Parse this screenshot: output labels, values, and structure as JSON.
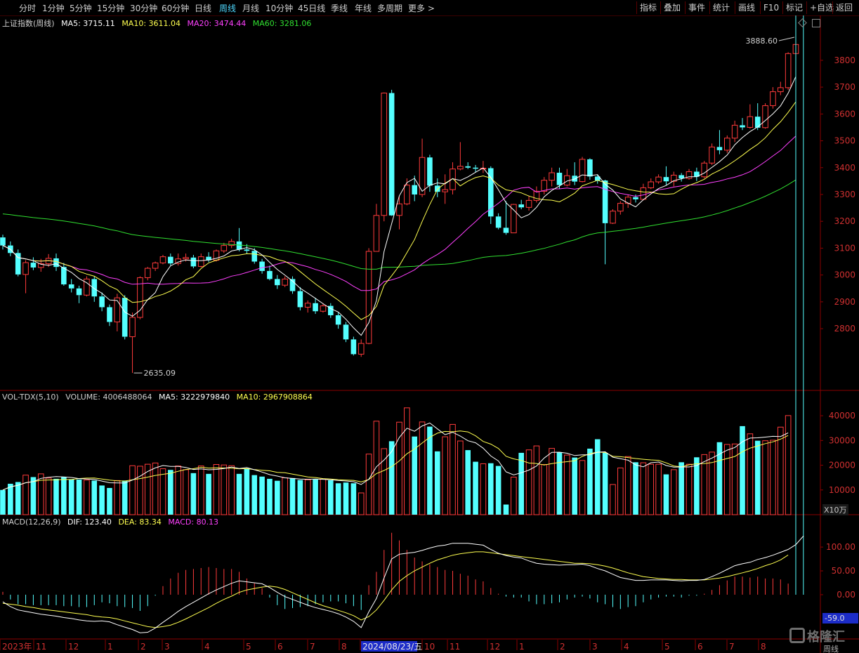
{
  "toolbar": {
    "items": [
      "分时",
      "1分钟",
      "5分钟",
      "15分钟",
      "30分钟",
      "60分钟",
      "日线",
      "周线",
      "月线",
      "10分钟",
      "45日线",
      "季线",
      "年线",
      "多周期",
      "更多 >"
    ],
    "active": "周线",
    "right_items": [
      "指标",
      "叠加",
      "事件",
      "统计",
      "画线",
      "F10",
      "标记",
      "+自选",
      "返回"
    ]
  },
  "price_panel": {
    "title": "上证指数(周线)",
    "ma5": "MA5: 3715.11",
    "ma10": "MA10: 3611.04",
    "ma20": "MA20: 3474.44",
    "ma60": "MA60: 3281.06",
    "high_label": "3888.60",
    "low_label": "2635.09"
  },
  "vol_panel": {
    "title": "VOL-TDX(5,10)",
    "volume": "VOLUME: 4006488064",
    "ma5": "MA5: 3222979840",
    "ma10": "MA10: 2967908864",
    "unit": "X10万"
  },
  "macd_panel": {
    "title": "MACD(12,26,9)",
    "dif": "DIF: 123.40",
    "dea": "DEA: 83.34",
    "macd": "MACD: 80.13",
    "readout": "-59.0"
  },
  "x_axis": {
    "labels": [
      "2023年",
      "11",
      "12",
      "1",
      "2",
      "3",
      "4",
      "5",
      "6",
      "7",
      "8",
      "2024/08/23/五",
      "10",
      "11",
      "12",
      "1",
      "2",
      "3",
      "4",
      "5",
      "6",
      "7",
      "8"
    ],
    "axis_name": "周线"
  },
  "watermark": "格隆汇",
  "colors": {
    "up": "#ff3b3b",
    "down": "#54ffff",
    "ma5": "#ffffff",
    "ma10": "#ffff50",
    "ma20": "#ff40ff",
    "ma60": "#30e030",
    "frame": "#8b0000"
  },
  "chart_data": {
    "type": "candlestick",
    "price_axis": {
      "ticks": [
        2800,
        2900,
        3000,
        3100,
        3200,
        3300,
        3400,
        3500,
        3600,
        3700,
        3800
      ],
      "ylim": [
        2570,
        3920
      ]
    },
    "volume_axis": {
      "ticks": [
        10000,
        20000,
        30000,
        40000
      ],
      "ylim": [
        0,
        44000
      ]
    },
    "macd_axis": {
      "ticks": [
        0,
        50,
        100
      ],
      "ylim": [
        -90,
        140
      ]
    },
    "candles": [
      [
        3140,
        3110,
        3150,
        3095
      ],
      [
        3110,
        3082,
        3125,
        3070
      ],
      [
        3082,
        3002,
        3095,
        2995
      ],
      [
        3002,
        3046,
        3055,
        2932
      ],
      [
        3046,
        3028,
        3066,
        3018
      ],
      [
        3028,
        3042,
        3060,
        3012
      ],
      [
        3042,
        3062,
        3078,
        3030
      ],
      [
        3062,
        3030,
        3080,
        3015
      ],
      [
        3030,
        2965,
        3045,
        2960
      ],
      [
        2965,
        2950,
        2985,
        2935
      ],
      [
        2950,
        2925,
        2960,
        2895
      ],
      [
        2925,
        2985,
        2995,
        2920
      ],
      [
        2985,
        2920,
        2995,
        2900
      ],
      [
        2920,
        2880,
        2935,
        2865
      ],
      [
        2880,
        2825,
        2890,
        2810
      ],
      [
        2825,
        2915,
        2930,
        2790
      ],
      [
        2915,
        2770,
        2925,
        2760
      ],
      [
        2770,
        2842,
        2860,
        2635
      ],
      [
        2842,
        2990,
        2995,
        2835
      ],
      [
        2990,
        3025,
        3030,
        2980
      ],
      [
        3025,
        3045,
        3050,
        3015
      ],
      [
        3045,
        3068,
        3075,
        3040
      ],
      [
        3068,
        3043,
        3080,
        3035
      ],
      [
        3043,
        3060,
        3080,
        3035
      ],
      [
        3060,
        3065,
        3080,
        3050
      ],
      [
        3065,
        3032,
        3075,
        3025
      ],
      [
        3032,
        3068,
        3080,
        3028
      ],
      [
        3068,
        3055,
        3085,
        3048
      ],
      [
        3055,
        3090,
        3095,
        3050
      ],
      [
        3090,
        3110,
        3120,
        3082
      ],
      [
        3110,
        3125,
        3135,
        3100
      ],
      [
        3125,
        3095,
        3175,
        3088
      ],
      [
        3095,
        3090,
        3115,
        3080
      ],
      [
        3090,
        3050,
        3100,
        3042
      ],
      [
        3050,
        3015,
        3060,
        3005
      ],
      [
        3015,
        2985,
        3035,
        2980
      ],
      [
        2985,
        2962,
        3000,
        2948
      ],
      [
        2962,
        2985,
        2995,
        2955
      ],
      [
        2985,
        2940,
        2995,
        2930
      ],
      [
        2940,
        2880,
        2955,
        2868
      ],
      [
        2880,
        2895,
        2905,
        2860
      ],
      [
        2895,
        2865,
        2915,
        2855
      ],
      [
        2865,
        2885,
        2895,
        2860
      ],
      [
        2885,
        2850,
        2895,
        2840
      ],
      [
        2850,
        2815,
        2860,
        2800
      ],
      [
        2815,
        2760,
        2825,
        2750
      ],
      [
        2760,
        2705,
        2770,
        2700
      ],
      [
        2705,
        2745,
        2760,
        2695
      ],
      [
        2745,
        3088,
        3100,
        2742
      ],
      [
        3088,
        3222,
        3265,
        3165
      ],
      [
        3222,
        3678,
        3680,
        3200
      ],
      [
        3678,
        3222,
        3690,
        3220
      ],
      [
        3222,
        3265,
        3295,
        3170
      ],
      [
        3265,
        3335,
        3360,
        3260
      ],
      [
        3335,
        3300,
        3370,
        3275
      ],
      [
        3300,
        3438,
        3508,
        3290
      ],
      [
        3438,
        3333,
        3448,
        3310
      ],
      [
        3333,
        3310,
        3360,
        3290
      ],
      [
        3310,
        3318,
        3375,
        3265
      ],
      [
        3318,
        3395,
        3420,
        3300
      ],
      [
        3395,
        3405,
        3495,
        3390
      ],
      [
        3405,
        3400,
        3420,
        3395
      ],
      [
        3400,
        3396,
        3410,
        3382
      ],
      [
        3396,
        3398,
        3425,
        3380
      ],
      [
        3398,
        3218,
        3405,
        3190
      ],
      [
        3218,
        3176,
        3230,
        3170
      ],
      [
        3176,
        3157,
        3275,
        3150
      ],
      [
        3157,
        3263,
        3265,
        3240
      ],
      [
        3263,
        3252,
        3280,
        3245
      ],
      [
        3252,
        3278,
        3295,
        3240
      ],
      [
        3278,
        3312,
        3330,
        3270
      ],
      [
        3312,
        3353,
        3365,
        3300
      ],
      [
        3353,
        3381,
        3400,
        3330
      ],
      [
        3381,
        3335,
        3400,
        3320
      ],
      [
        3335,
        3370,
        3395,
        3330
      ],
      [
        3370,
        3348,
        3420,
        3335
      ],
      [
        3348,
        3431,
        3440,
        3345
      ],
      [
        3431,
        3367,
        3435,
        3355
      ],
      [
        3367,
        3352,
        3375,
        3340
      ],
      [
        3352,
        3193,
        3355,
        3040
      ],
      [
        3193,
        3238,
        3245,
        3190
      ],
      [
        3238,
        3267,
        3275,
        3225
      ],
      [
        3267,
        3290,
        3300,
        3250
      ],
      [
        3290,
        3282,
        3300,
        3270
      ],
      [
        3282,
        3325,
        3340,
        3278
      ],
      [
        3325,
        3347,
        3360,
        3320
      ],
      [
        3347,
        3365,
        3375,
        3340
      ],
      [
        3365,
        3349,
        3405,
        3335
      ],
      [
        3349,
        3372,
        3385,
        3330
      ],
      [
        3372,
        3360,
        3380,
        3348
      ],
      [
        3360,
        3385,
        3395,
        3355
      ],
      [
        3385,
        3366,
        3400,
        3350
      ],
      [
        3366,
        3417,
        3425,
        3360
      ],
      [
        3417,
        3477,
        3490,
        3410
      ],
      [
        3477,
        3465,
        3540,
        3450
      ],
      [
        3465,
        3510,
        3520,
        3455
      ],
      [
        3510,
        3558,
        3575,
        3495
      ],
      [
        3558,
        3550,
        3585,
        3540
      ],
      [
        3550,
        3590,
        3636,
        3545
      ],
      [
        3590,
        3549,
        3640,
        3540
      ],
      [
        3549,
        3631,
        3640,
        3545
      ],
      [
        3631,
        3683,
        3700,
        3620
      ],
      [
        3683,
        3698,
        3720,
        3670
      ],
      [
        3698,
        3825,
        3830,
        3690
      ],
      [
        3825,
        3859,
        3888.6,
        3760
      ]
    ],
    "volume": [
      10000,
      12500,
      13200,
      16000,
      15200,
      16500,
      14800,
      14500,
      15200,
      14200,
      14200,
      14000,
      13800,
      11800,
      10800,
      13800,
      13800,
      19800,
      19600,
      20400,
      20900,
      18600,
      18100,
      19700,
      18200,
      16800,
      19700,
      16500,
      20300,
      20100,
      19800,
      16500,
      18500,
      16000,
      15400,
      14500,
      13700,
      14900,
      14800,
      14000,
      14100,
      14200,
      14400,
      13900,
      12700,
      13000,
      12700,
      8800,
      24500,
      37800,
      26700,
      29700,
      37400,
      43200,
      31600,
      37500,
      35600,
      25600,
      31500,
      36500,
      29800,
      26100,
      21400,
      20600,
      20800,
      19700,
      4100,
      15200,
      25000,
      26200,
      27800,
      20300,
      26800,
      25200,
      24100,
      23100,
      21900,
      26700,
      30500,
      25000,
      12200,
      18900,
      23500,
      21200,
      21000,
      20400,
      20400,
      16300,
      18200,
      21200,
      20400,
      23200,
      24300,
      25300,
      29300,
      28400,
      28600,
      35800,
      32700,
      29900,
      29900,
      30100,
      35400,
      40060
    ],
    "macd": {
      "dif": [
        -15,
        -25,
        -32,
        -35,
        -38,
        -41,
        -43,
        -45,
        -48,
        -50,
        -53,
        -55,
        -56,
        -55,
        -57,
        -63,
        -68,
        -73,
        -80,
        -79,
        -70,
        -58,
        -47,
        -35,
        -25,
        -16,
        -7,
        2,
        10,
        17,
        24,
        29,
        27,
        25,
        23,
        15,
        5,
        -4,
        -10,
        -16,
        -22,
        -27,
        -31,
        -35,
        -40,
        -47,
        -56,
        -69,
        -36,
        -8,
        35,
        75,
        85,
        87,
        89,
        93,
        98,
        102,
        104,
        108,
        108,
        108,
        106,
        104,
        95,
        87,
        82,
        79,
        77,
        71,
        66,
        64,
        63,
        62,
        63,
        63,
        64,
        61,
        55,
        50,
        43,
        36,
        33,
        30,
        30,
        31,
        31,
        31,
        30,
        29,
        30,
        30,
        32,
        38,
        45,
        53,
        61,
        65,
        68,
        74,
        78,
        83,
        89,
        95,
        105,
        123.4
      ],
      "dea": [
        -18,
        -20,
        -22,
        -25,
        -27,
        -30,
        -32,
        -34,
        -36,
        -38,
        -40,
        -42,
        -45,
        -47,
        -48,
        -51,
        -55,
        -59,
        -63,
        -67,
        -69,
        -67,
        -64,
        -58,
        -51,
        -43,
        -35,
        -27,
        -18,
        -10,
        -3,
        5,
        10,
        13,
        16,
        18,
        16,
        11,
        4,
        -3,
        -10,
        -17,
        -23,
        -28,
        -33,
        -38,
        -44,
        -53,
        -46,
        -32,
        -12,
        10,
        28,
        40,
        50,
        58,
        66,
        73,
        78,
        83,
        86,
        88,
        90,
        90,
        88,
        86,
        84,
        82,
        80,
        78,
        76,
        74,
        72,
        70,
        68,
        66,
        66,
        65,
        63,
        60,
        56,
        51,
        46,
        42,
        38,
        36,
        34,
        33,
        32,
        32,
        31,
        31,
        31,
        33,
        35,
        38,
        42,
        46,
        50,
        55,
        61,
        66,
        73,
        83.34
      ]
    }
  }
}
